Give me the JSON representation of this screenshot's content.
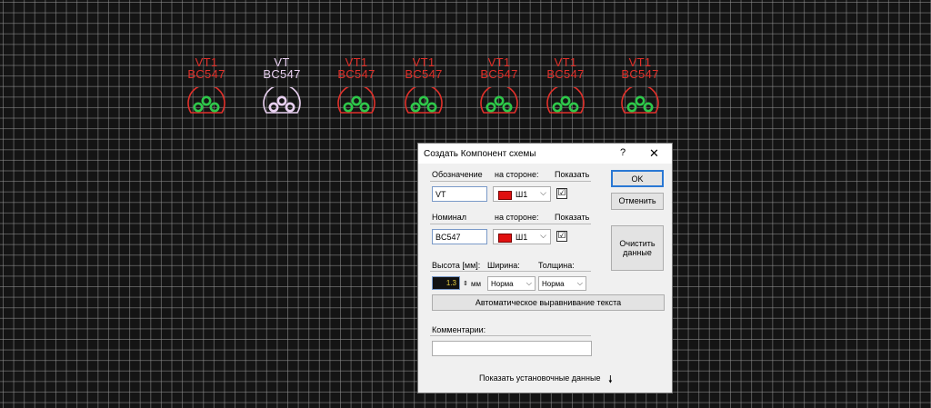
{
  "components": [
    {
      "ref": "VT1",
      "value": "BC547",
      "color": "#e0302a"
    },
    {
      "ref": "VT",
      "value": "BC547",
      "color": "#e8d0f0"
    },
    {
      "ref": "VT1",
      "value": "BC547",
      "color": "#e0302a"
    },
    {
      "ref": "VT1",
      "value": "BC547",
      "color": "#e0302a"
    },
    {
      "ref": "VT1",
      "value": "BC547",
      "color": "#e0302a"
    },
    {
      "ref": "VT1",
      "value": "BC547",
      "color": "#e0302a"
    },
    {
      "ref": "VT1",
      "value": "BC547",
      "color": "#e0302a"
    }
  ],
  "dialog": {
    "title": "Создать Компонент схемы",
    "help": "?",
    "close": "✕",
    "designation": {
      "label": "Обозначение",
      "side_label": "на стороне:",
      "show_label": "Показать",
      "value": "VT",
      "side_value": "Ш1",
      "show_checked": "☑"
    },
    "nominal": {
      "label": "Номинал",
      "side_label": "на стороне:",
      "show_label": "Показать",
      "value": "BC547",
      "side_value": "Ш1",
      "show_checked": "☑"
    },
    "size": {
      "height_label": "Высота [мм]:",
      "width_label": "Ширина:",
      "thickness_label": "Толщина:",
      "height_value": "1.3",
      "height_unit": "мм",
      "width_value": "Норма",
      "thickness_value": "Норма"
    },
    "auto_align_label": "Автоматическое выравнивание текста",
    "comment_label": "Комментарии:",
    "comment_value": "",
    "show_install_label": "Показать установочные данные",
    "ok_label": "OK",
    "cancel_label": "Отменить",
    "clear_label_1": "Очистить",
    "clear_label_2": "данные"
  },
  "colors": {
    "background": "#141414",
    "grid": "#969696",
    "component_red": "#e0302a",
    "component_selected": "#e8d0f0",
    "pad_green": "#2ec84a",
    "dialog_bg": "#f0f0f0"
  }
}
